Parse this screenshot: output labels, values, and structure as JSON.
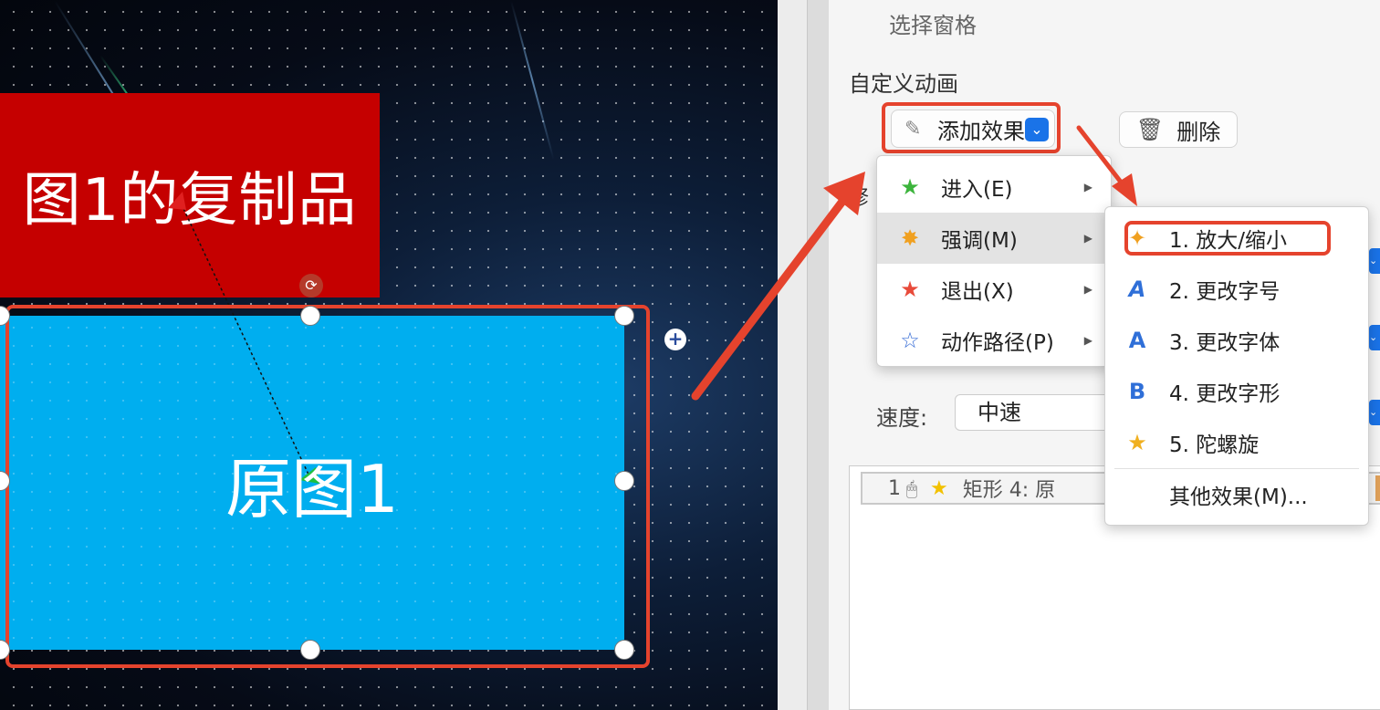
{
  "slide": {
    "copy_shape_text": "图1的复制品",
    "original_shape_text": "原图1",
    "copy_shape_color": "#c50000",
    "original_shape_color": "#00aeef"
  },
  "pane": {
    "selection_pane_link": "选择窗格",
    "custom_animation_title": "自定义动画",
    "add_effect_label": "添加效果",
    "delete_label": "删除",
    "modify_label_partial": "修",
    "speed_label": "速度:",
    "speed_value": "中速",
    "animation_list": [
      {
        "order": "1",
        "text": "矩形 4: 原"
      }
    ]
  },
  "effect_menu": {
    "items": [
      {
        "label": "进入(E)",
        "icon": "green-star-icon",
        "color": "#3cb43c"
      },
      {
        "label": "强调(M)",
        "icon": "yellow-burst-icon",
        "color": "#f0a020"
      },
      {
        "label": "退出(X)",
        "icon": "red-star-icon",
        "color": "#e84a3a"
      },
      {
        "label": "动作路径(P)",
        "icon": "outline-star-icon",
        "color": "#3a6fd6"
      }
    ],
    "active_index": 1
  },
  "emphasis_menu": {
    "items": [
      {
        "label": "1. 放大/缩小",
        "icon": "grow-shrink-icon"
      },
      {
        "label": "2. 更改字号",
        "icon": "font-size-icon",
        "glyph": "A"
      },
      {
        "label": "3. 更改字体",
        "icon": "font-face-icon",
        "glyph": "A"
      },
      {
        "label": "4. 更改字形",
        "icon": "font-style-icon",
        "glyph": "B"
      },
      {
        "label": "5. 陀螺旋",
        "icon": "spin-icon"
      }
    ],
    "more_label": "其他效果(M)..."
  },
  "colors": {
    "accent_blue": "#1a73e8",
    "annotation_red": "#e5432d"
  }
}
